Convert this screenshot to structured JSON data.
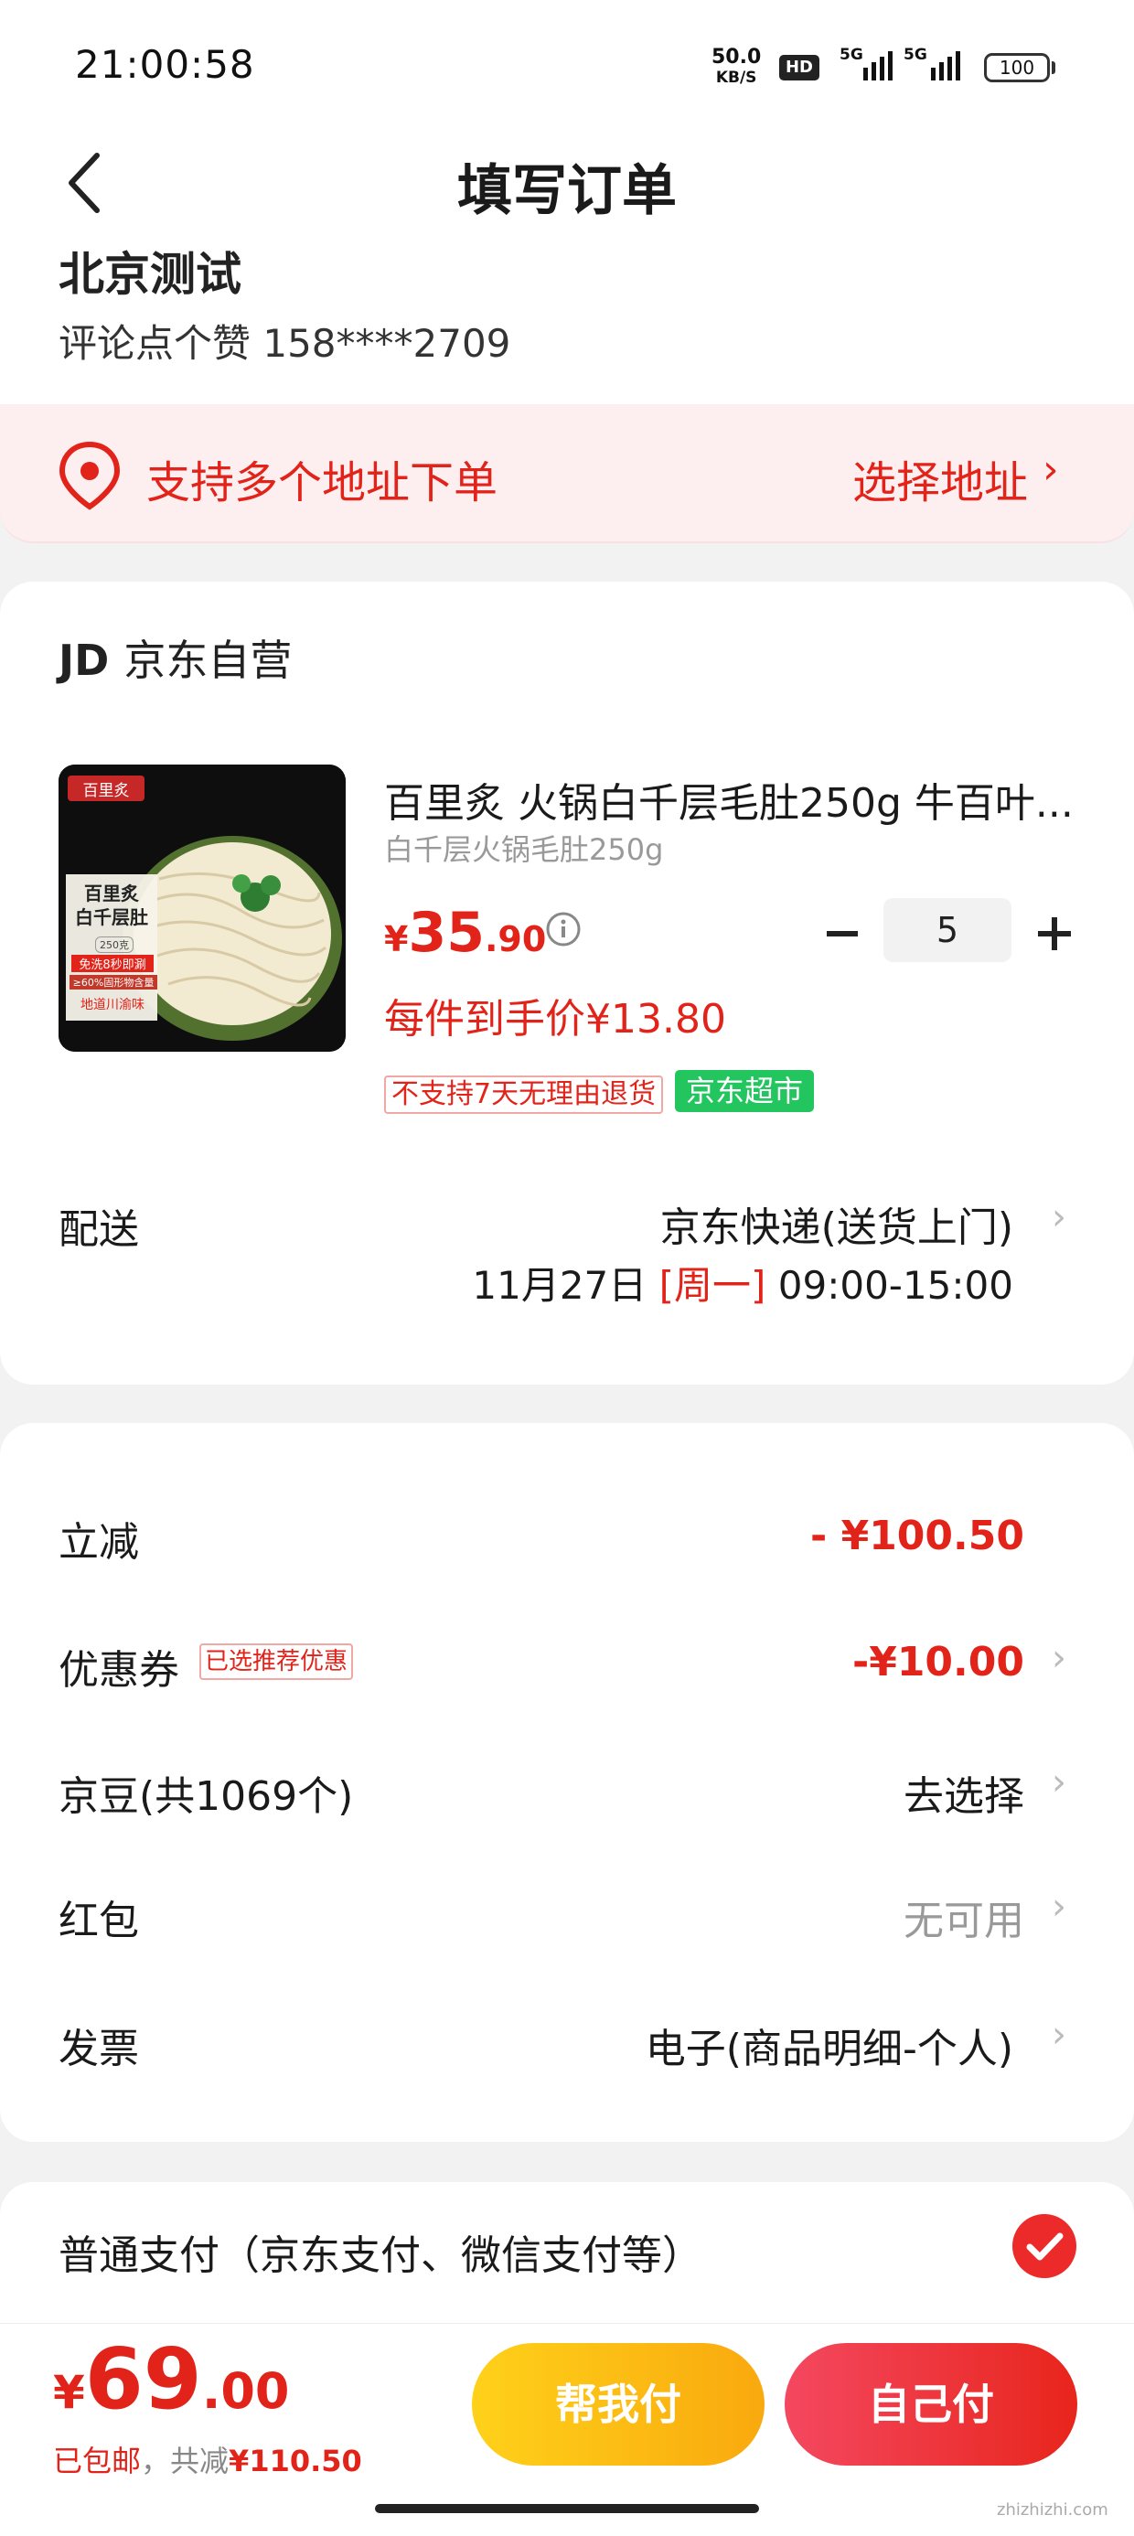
{
  "status_bar": {
    "time": "21:00:58",
    "net_speed": "50.0",
    "net_unit": "KB/S",
    "hd": "HD",
    "sig1": "5G",
    "sig2": "5G",
    "battery": "100"
  },
  "header": {
    "title": "填写订单",
    "back_icon": "chevron-left-icon"
  },
  "address": {
    "name": "北京测试",
    "contact": "评论点个赞  158****2709",
    "multi_address_text": "支持多个地址下单",
    "select_address_label": "选择地址",
    "chevron": "›"
  },
  "shop": {
    "logo": "JD",
    "name": "京东自营"
  },
  "product": {
    "title": "百里炙 火锅白千层毛肚250g 牛百叶...",
    "spec": "白千层火锅毛肚250g",
    "price_symbol": "¥",
    "price_int": "35",
    "price_dec": ".90",
    "quantity": "5",
    "unit_price_label": "每件到手价¥13.80",
    "tag_no_return": "不支持7天无理由退货",
    "tag_supermarket": "京东超市",
    "image": {
      "brand": "百里炙",
      "name_line1": "百里炙",
      "name_line2": "白千层肚",
      "weight": "250克",
      "feature1": "免洗8秒即涮",
      "feature2": "≥60%固形物含量",
      "feature3": "地道川渝味"
    }
  },
  "delivery": {
    "label": "配送",
    "method": "京东快递(送货上门)",
    "date": "11月27日",
    "weekday": "[周一]",
    "time": "09:00-15:00"
  },
  "discounts": {
    "instant_label": "立减",
    "instant_value": "- ¥100.50",
    "coupon_label": "优惠券",
    "coupon_badge": "已选推荐优惠",
    "coupon_value": "-¥10.00",
    "jingdou_label": "京豆(共1069个)",
    "jingdou_value": "去选择",
    "redpack_label": "红包",
    "redpack_value": "无可用",
    "invoice_label": "发票",
    "invoice_value": "电子(商品明细-个人)"
  },
  "payment": {
    "label": "普通支付（京东支付、微信支付等）"
  },
  "bottom": {
    "total_symbol": "¥",
    "total_int": "69",
    "total_dec": ".00",
    "shipping": "已包邮",
    "separator": "，",
    "saved_label": "共减",
    "saved_amount": "¥110.50",
    "btn_friend": "帮我付",
    "btn_self": "自己付",
    "watermark": "zhizhizhi.com"
  },
  "colors": {
    "accent_red": "#e2231a",
    "market_green": "#22c55e",
    "pay_yellow": "#f9a90e"
  }
}
